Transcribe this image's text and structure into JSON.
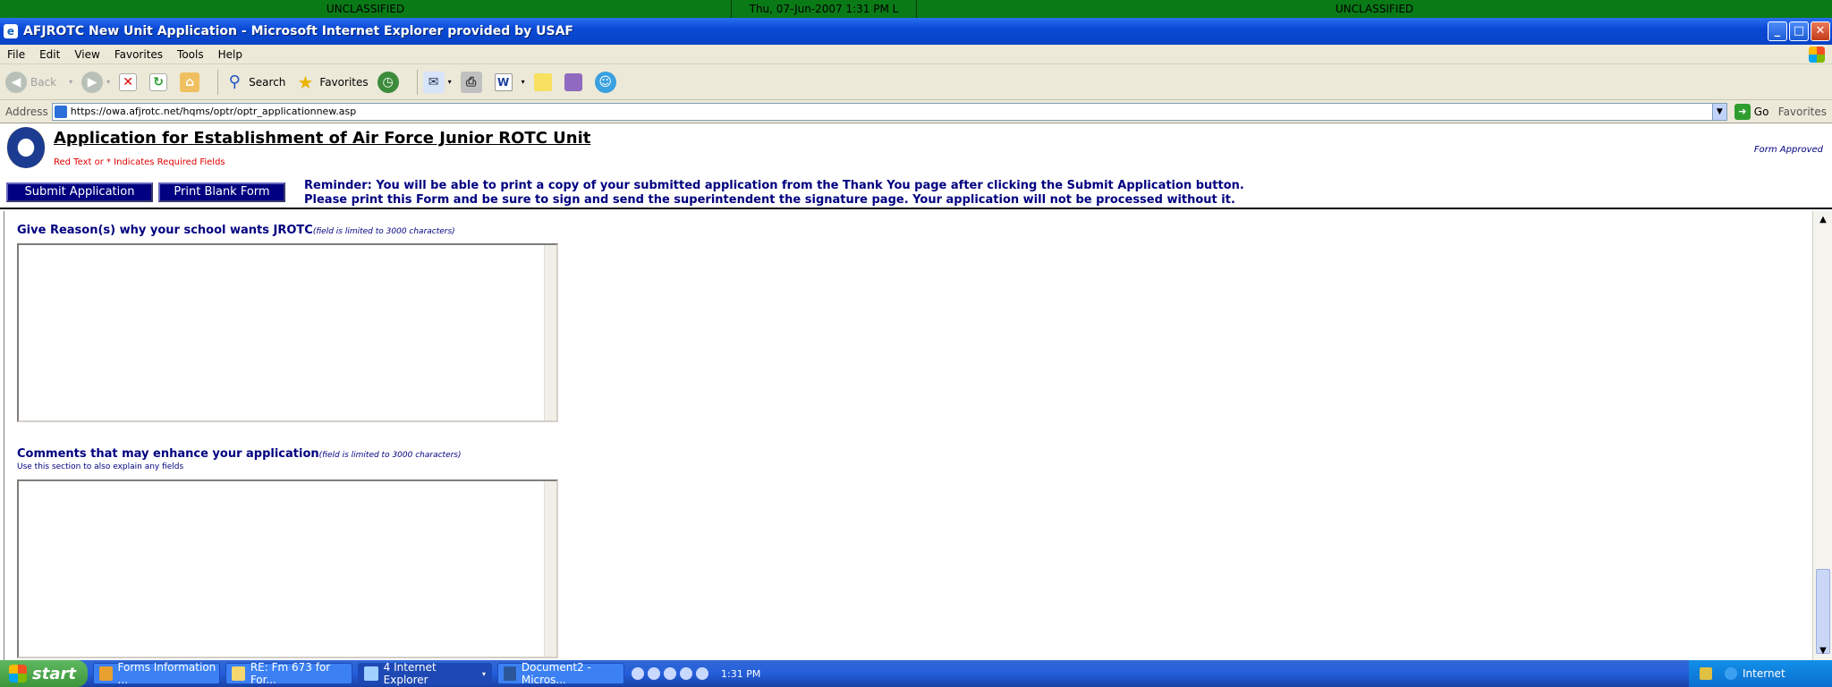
{
  "banner": {
    "left": "UNCLASSIFIED",
    "center": "Thu, 07-Jun-2007 1:31 PM L",
    "right": "UNCLASSIFIED"
  },
  "window": {
    "title": "AFJROTC New Unit Application - Microsoft Internet Explorer provided by USAF"
  },
  "menu": [
    "File",
    "Edit",
    "View",
    "Favorites",
    "Tools",
    "Help"
  ],
  "toolbar": {
    "back": "Back",
    "search": "Search",
    "favorites": "Favorites"
  },
  "address": {
    "label": "Address",
    "url": "https://owa.afjrotc.net/hqms/optr/optr_applicationnew.asp",
    "go": "Go",
    "links": "Favorites"
  },
  "page": {
    "title": "Application for Establishment of Air Force Junior ROTC Unit",
    "required_note": "Red Text or * Indicates Required Fields",
    "form_approved": "Form Approved",
    "submit_label": "Submit Application",
    "print_label": "Print Blank Form",
    "reminder_1": "Reminder: You will be able to print a copy of your submitted application from the Thank You page after clicking the Submit Application button.",
    "reminder_2": "Please print this Form and be sure to sign and send the superintendent the signature page. Your application will not be processed without it.",
    "reason_label": "Give Reason(s) why your school wants JROTC",
    "reason_limit": "(field is limited to 3000 characters)",
    "comments_label": "Comments that may enhance your application",
    "comments_limit": "(field is limited to 3000 characters)",
    "comments_sub": "Use this section to also explain any fields"
  },
  "taskbar": {
    "start": "start",
    "tasks": [
      "Forms Information ...",
      "RE: Fm 673 for For...",
      "4 Internet Explorer",
      "Document2 - Micros..."
    ],
    "clock": "1:31 PM",
    "zone": "Internet"
  }
}
